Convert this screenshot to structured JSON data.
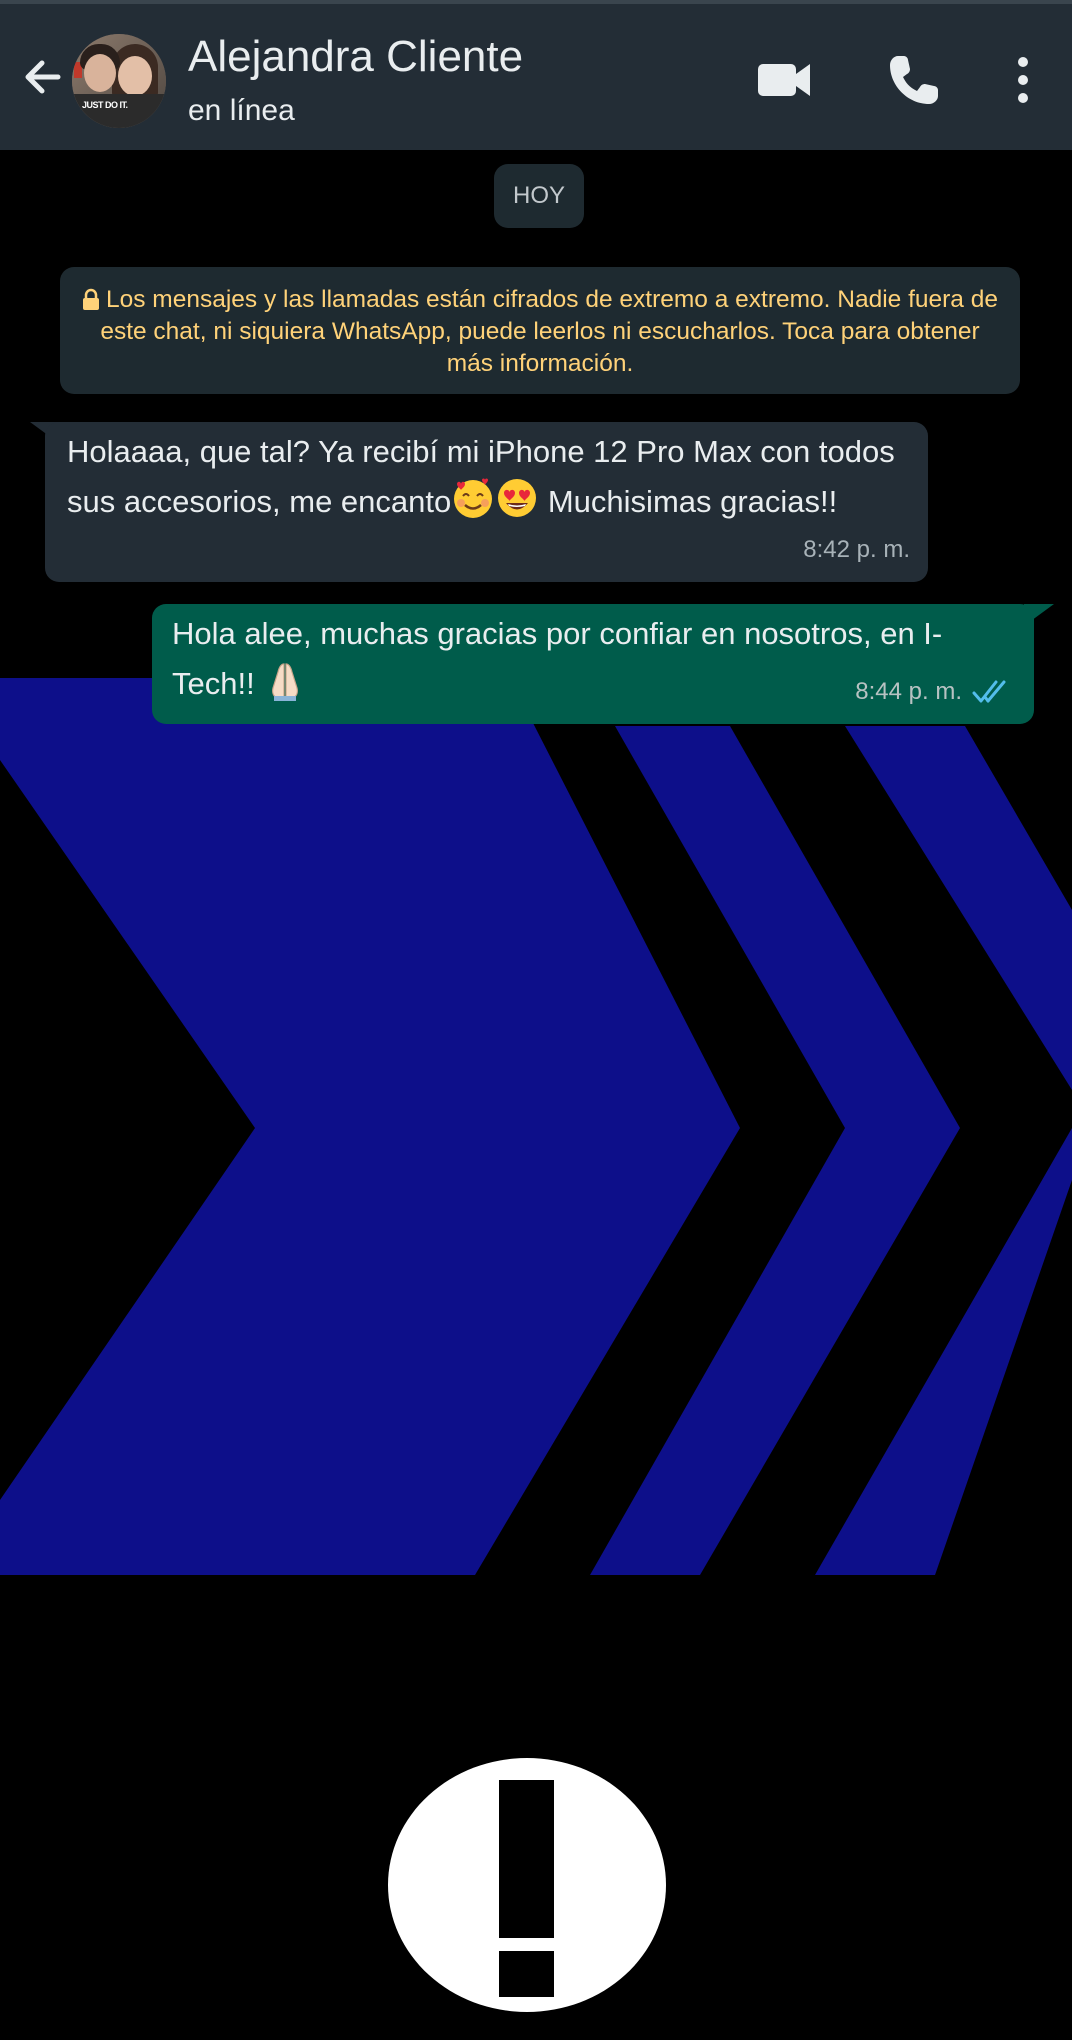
{
  "colors": {
    "header_bg": "#232d36",
    "incoming_bubble": "#232d36",
    "outgoing_bubble": "#005c4b",
    "system_text": "#ffd279",
    "read_ticks": "#53bdeb",
    "wallpaper_chevrons": "#0d0f8a"
  },
  "header": {
    "contact_name": "Alejandra Cliente",
    "status": "en línea",
    "avatar_shirt_text": "JUST DO IT.",
    "icons": [
      "back-arrow-icon",
      "video-call-icon",
      "phone-call-icon",
      "more-options-icon"
    ]
  },
  "chat": {
    "date_chip": "HOY",
    "encryption_notice": "Los mensajes y las llamadas están cifrados de extremo a extremo. Nadie fuera de este chat, ni siquiera WhatsApp, puede leerlos ni escucharlos. Toca para obtener más información.",
    "messages": [
      {
        "direction": "incoming",
        "text_part1": "Holaaaa, que tal? Ya recibí mi iPhone 12 Pro Max con todos sus accesorios, me encanto",
        "emojis": [
          "smiling-face-with-hearts",
          "heart-eyes"
        ],
        "text_part2": " Muchisimas gracias!!",
        "time": "8:42 p. m."
      },
      {
        "direction": "outgoing",
        "text": "Hola alee, muchas gracias por confiar en nosotros, en I-Tech!! ",
        "emojis": [
          "folded-hands"
        ],
        "time": "8:44 p. m.",
        "status": "read"
      }
    ]
  },
  "wallpaper": {
    "pattern": "blue chevrons",
    "overlay_icon": "exclamation-circle"
  }
}
